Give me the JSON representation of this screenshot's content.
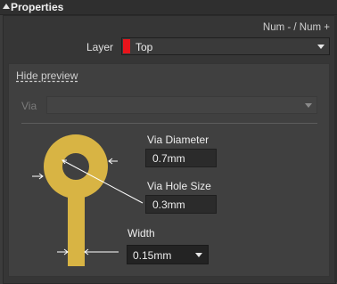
{
  "panel": {
    "title": "Properties"
  },
  "shortcut_hint": "Num - / Num +",
  "layer": {
    "label": "Layer",
    "value": "Top",
    "swatch_color": "#e8141b"
  },
  "preview": {
    "toggle_label": "Hide preview"
  },
  "via": {
    "label": "Via",
    "value": ""
  },
  "dimensions": {
    "via_diameter": {
      "label": "Via Diameter",
      "value": "0.7mm"
    },
    "via_hole_size": {
      "label": "Via Hole Size",
      "value": "0.3mm"
    },
    "width": {
      "label": "Width",
      "value": "0.15mm"
    }
  },
  "colors": {
    "pad": "#d8b444",
    "hole": "#404040",
    "panel_bg": "#363636"
  }
}
